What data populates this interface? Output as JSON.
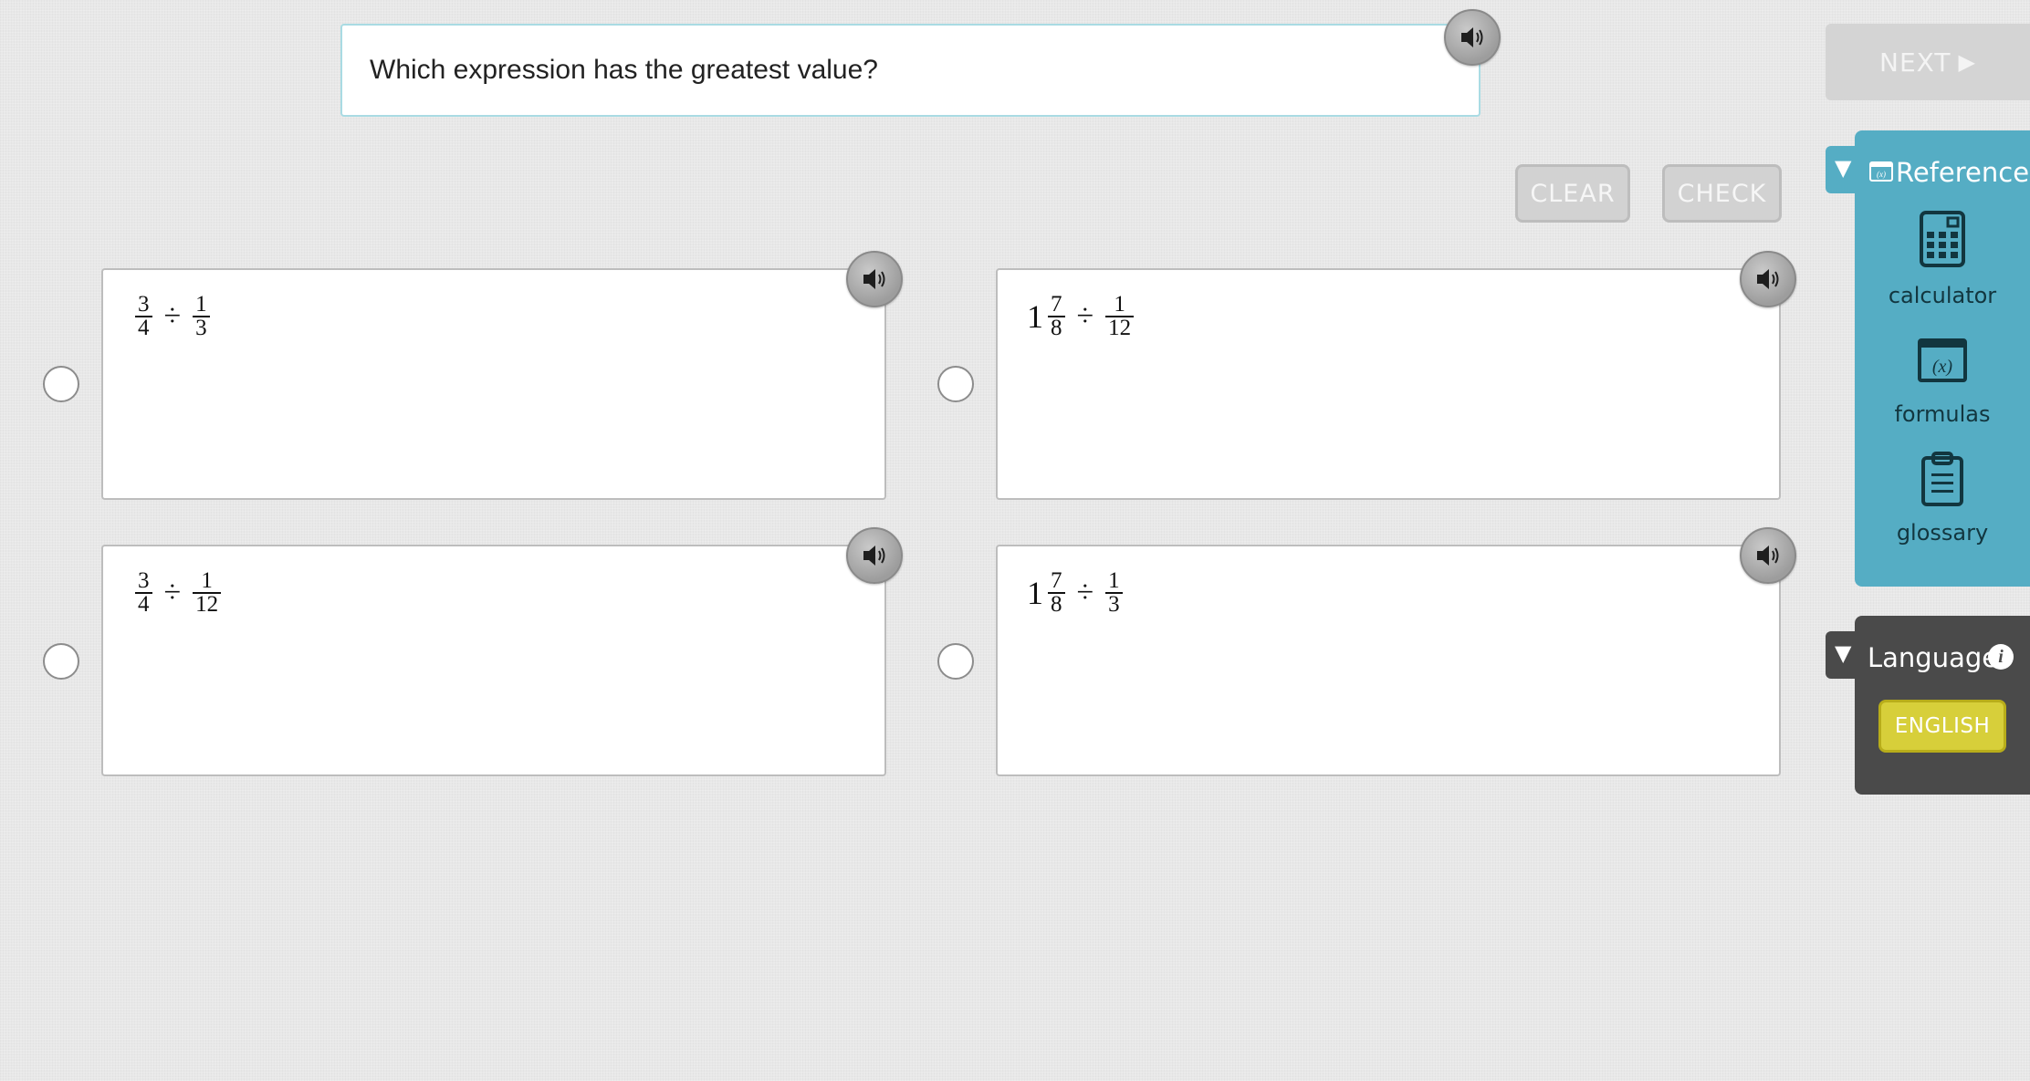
{
  "question": {
    "text": "Which expression has the greatest value?"
  },
  "toolbar": {
    "clear_label": "CLEAR",
    "check_label": "CHECK",
    "next_label": "NEXT",
    "next_icon": "▶"
  },
  "answers": [
    {
      "whole": "",
      "a_num": "3",
      "a_den": "4",
      "operator": "÷",
      "b_num": "1",
      "b_den": "3"
    },
    {
      "whole": "1",
      "a_num": "7",
      "a_den": "8",
      "operator": "÷",
      "b_num": "1",
      "b_den": "12"
    },
    {
      "whole": "",
      "a_num": "3",
      "a_den": "4",
      "operator": "÷",
      "b_num": "1",
      "b_den": "12"
    },
    {
      "whole": "1",
      "a_num": "7",
      "a_den": "8",
      "operator": "÷",
      "b_num": "1",
      "b_den": "3"
    }
  ],
  "reference": {
    "header": "Reference",
    "toggle_icon": "▼",
    "tools": [
      {
        "label": "calculator",
        "icon": "calculator-icon"
      },
      {
        "label": "formulas",
        "icon": "formulas-icon"
      },
      {
        "label": "glossary",
        "icon": "glossary-icon"
      }
    ]
  },
  "language": {
    "header": "Language",
    "toggle_icon": "▼",
    "info_icon": "i",
    "selected": "ENGLISH"
  },
  "colors": {
    "reference_panel": "#55adc4",
    "language_panel": "#4a4a4a",
    "english_button": "#d7cf3a"
  }
}
